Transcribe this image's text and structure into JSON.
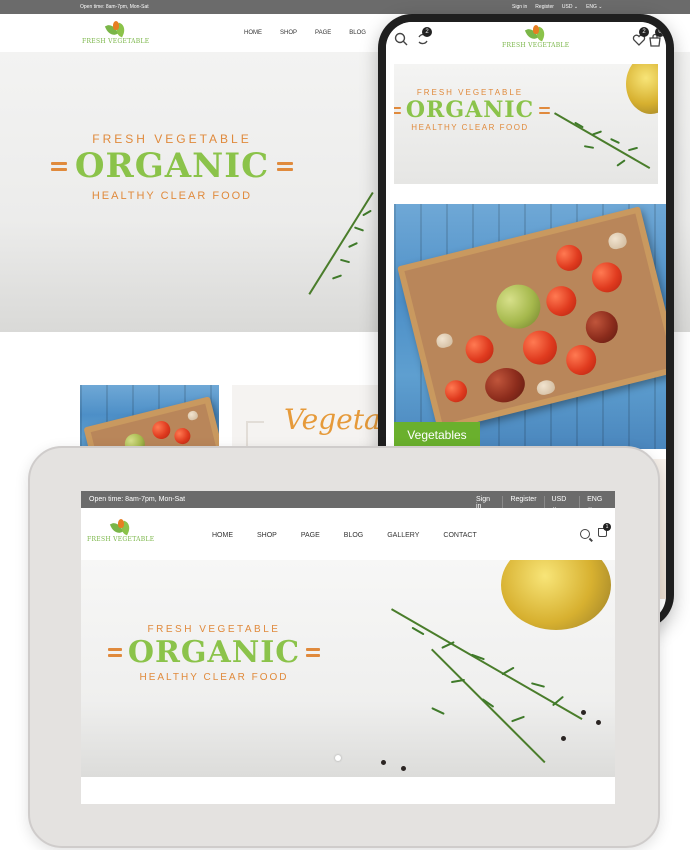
{
  "brand": {
    "logo_text": "FRESH VEGETABLE",
    "green": "#8bc34a",
    "orange": "#e08a3c",
    "topbar_bg": "#6b6b6b"
  },
  "desktop": {
    "topbar": {
      "open_time": "Open time: 8am-7pm, Mon-Sat",
      "sign_in": "Sign in",
      "register": "Register",
      "currency": "USD ⌄",
      "language": "ENG ⌄"
    },
    "menu": [
      "HOME",
      "SHOP",
      "PAGE",
      "BLOG",
      "G"
    ],
    "hero": {
      "top": "FRESH VEGETABLE",
      "main": "ORGANIC",
      "bottom": "HEALTHY CLEAR FOOD"
    },
    "banner_script": "Vegetab"
  },
  "phone": {
    "badges": {
      "compare": "2",
      "wishlist": "2",
      "cart": "0"
    },
    "hero": {
      "top": "FRESH VEGETABLE",
      "main": "ORGANIC",
      "bottom": "HEALTHY CLEAR FOOD"
    },
    "category_label": "Vegetables"
  },
  "tablet": {
    "topbar": {
      "open_time": "Open time: 8am-7pm, Mon-Sat",
      "sign_in": "Sign in",
      "register": "Register",
      "currency": "USD ⌄",
      "language": "ENG ⌄"
    },
    "menu": [
      "HOME",
      "SHOP",
      "PAGE",
      "BLOG",
      "GALLERY",
      "CONTACT"
    ],
    "cart_count": "1",
    "hero": {
      "top": "FRESH VEGETABLE",
      "main": "ORGANIC",
      "bottom": "HEALTHY CLEAR FOOD"
    }
  }
}
